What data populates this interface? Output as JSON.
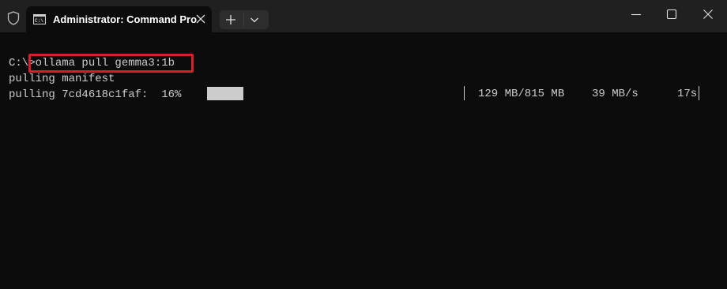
{
  "window": {
    "tab_title": "Administrator: Command Pro",
    "icons": {
      "shield": "shield-icon",
      "tab": "command-prompt-icon",
      "close_tab": "close-icon",
      "new_tab": "plus-icon",
      "dropdown": "chevron-down-icon",
      "minimize": "minimize-icon",
      "maximize": "maximize-icon",
      "close": "close-icon"
    }
  },
  "terminal": {
    "prompt": "C:\\>",
    "command": "ollama pull gemma3:1b",
    "line2": "pulling manifest",
    "line3_prefix": "pulling 7cd4618c1faf:  16%",
    "progress": {
      "percent": 16,
      "downloaded": "129 MB/815 MB",
      "speed": "39 MB/s",
      "eta": "17s"
    }
  },
  "colors": {
    "terminal_bg": "#0c0c0c",
    "titlebar_bg": "#202020",
    "text": "#cccccc",
    "highlight": "#d9202a"
  }
}
